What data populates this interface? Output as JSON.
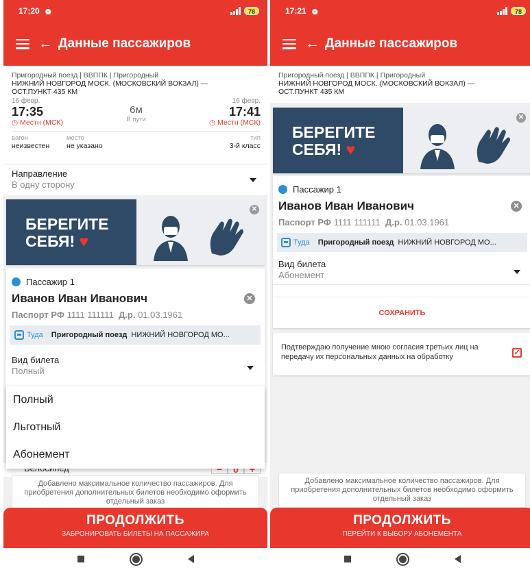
{
  "left": {
    "status": {
      "time": "17:20",
      "battery": "78"
    },
    "toolbar": {
      "title": "Данные пассажиров"
    },
    "trip": {
      "route": "Пригородный поезд | ВВППК | Пригородный",
      "stations_line1": "НИЖНИЙ НОВГОРОД МОСК. (МОСКОВСКИЙ ВОКЗАЛ) —",
      "stations_line2": "ОСТ.ПУНКТ 435 КМ",
      "dep_date": "16 февр.",
      "dep_time": "17:35",
      "dep_tz": "Местн (МСК)",
      "duration": "6м",
      "duration_label": "В пути",
      "arr_date": "16 февр.",
      "arr_time": "17:41",
      "arr_tz": "Местн (МСК)",
      "car_label": "вагон",
      "car_value": "неизвестен",
      "seat_label": "место",
      "seat_value": "не указано",
      "type_label": "тип",
      "type_value": "3-й класс"
    },
    "direction": {
      "label": "Направление",
      "value": "В одну сторону"
    },
    "banner": {
      "line1": "БЕРЕГИТЕ",
      "line2": "СЕБЯ!"
    },
    "passenger": {
      "header": "Пассажир 1",
      "name": "Иванов Иван Иванович",
      "doc_type": "Паспорт РФ",
      "doc_number": "1111 111111",
      "dob_label": "Д.р.",
      "dob": "01.03.1961",
      "trip_dir": "Туда",
      "train_name": "Пригородный поезд",
      "train_route": "НИЖНИЙ НОВГОРОД МО..."
    },
    "ticket": {
      "label": "Вид билета",
      "value": "Полный"
    },
    "dropdown_options": [
      "Полный",
      "Льготный",
      "Абонемент"
    ],
    "peek": {
      "label": "Велосипед"
    },
    "notice": "Добавлено максимальное количество пассажиров. Для приобретения дополнительных билетов необходимо оформить отдельный заказ",
    "cta": {
      "main": "ПРОДОЛЖИТЬ",
      "sub": "ЗАБРОНИРОВАТЬ БИЛЕТЫ НА ПАССАЖИРА"
    }
  },
  "right": {
    "status": {
      "time": "17:21",
      "battery": "78"
    },
    "toolbar": {
      "title": "Данные пассажиров"
    },
    "trip": {
      "route": "Пригородный поезд | ВВППК | Пригородный",
      "stations_line1": "НИЖНИЙ НОВГОРОД МОСК. (МОСКОВСКИЙ ВОКЗАЛ) —",
      "stations_line2": "ОСТ.ПУНКТ 435 КМ"
    },
    "banner": {
      "line1": "БЕРЕГИТЕ",
      "line2": "СЕБЯ!"
    },
    "passenger": {
      "header": "Пассажир 1",
      "name": "Иванов Иван Иванович",
      "doc_type": "Паспорт РФ",
      "doc_number": "1111 111111",
      "dob_label": "Д.р.",
      "dob": "01.03.1961",
      "trip_dir": "Туда",
      "train_name": "Пригородный поезд",
      "train_route": "НИЖНИЙ НОВГОРОД МО..."
    },
    "ticket": {
      "label": "Вид билета",
      "value": "Абонемент"
    },
    "save_label": "СОХРАНИТЬ",
    "consent": "Подтверждаю получение мною согласия третьих лиц на передачу их персональных данных на обработку",
    "notice": "Добавлено максимальное количество пассажиров. Для приобретения дополнительных билетов необходимо оформить отдельный заказ",
    "cta": {
      "main": "ПРОДОЛЖИТЬ",
      "sub": "ПЕРЕЙТИ К ВЫБОРУ АБОНЕМЕНТА"
    }
  }
}
